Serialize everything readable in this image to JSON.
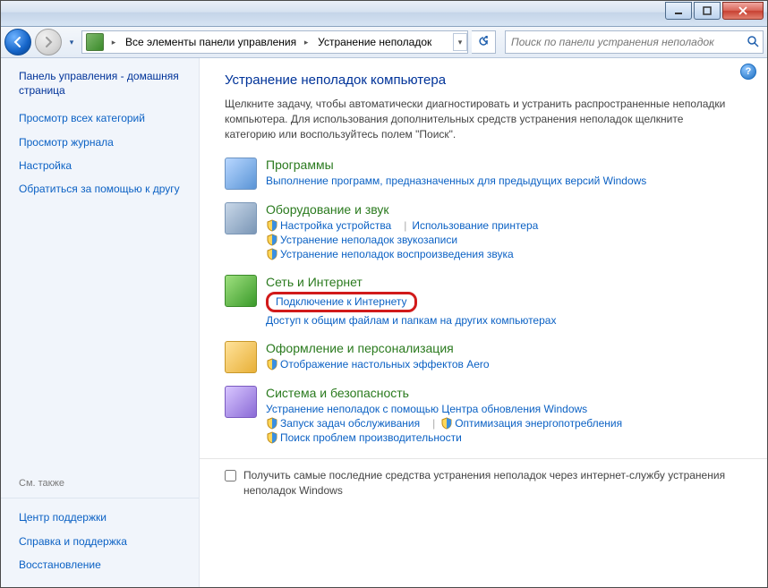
{
  "titlebar": {},
  "breadcrumb": {
    "item1": "Все элементы панели управления",
    "item2": "Устранение неполадок"
  },
  "search": {
    "placeholder": "Поиск по панели устранения неполадок"
  },
  "sidebar": {
    "heading": "Панель управления - домашняя страница",
    "links": [
      "Просмотр всех категорий",
      "Просмотр журнала",
      "Настройка",
      "Обратиться за помощью к другу"
    ],
    "seealso_label": "См. также",
    "seealso": [
      "Центр поддержки",
      "Справка и поддержка",
      "Восстановление"
    ]
  },
  "main": {
    "h1": "Устранение неполадок компьютера",
    "intro": "Щелкните задачу, чтобы автоматически диагностировать и устранить распространенные неполадки компьютера. Для использования дополнительных средств устранения неполадок щелкните категорию или воспользуйтесь полем \"Поиск\"."
  },
  "cat": {
    "programs": {
      "title": "Программы",
      "desc": "Выполнение программ, предназначенных для предыдущих версий Windows"
    },
    "hardware": {
      "title": "Оборудование и звук",
      "l1": "Настройка устройства",
      "l2": "Использование принтера",
      "l3": "Устранение неполадок звукозаписи",
      "l4": "Устранение неполадок воспроизведения звука"
    },
    "network": {
      "title": "Сеть и Интернет",
      "l1": "Подключение к Интернету",
      "l2": "Доступ к общим файлам и папкам на других компьютерах"
    },
    "personal": {
      "title": "Оформление и персонализация",
      "l1": "Отображение настольных эффектов Aero"
    },
    "system": {
      "title": "Система и безопасность",
      "l1": "Устранение неполадок с помощью Центра обновления Windows",
      "l2": "Запуск задач обслуживания",
      "l3": "Оптимизация энергопотребления",
      "l4": "Поиск проблем производительности"
    }
  },
  "footer": {
    "checkbox_label": "Получить самые последние средства устранения неполадок через интернет-службу устранения неполадок Windows"
  }
}
